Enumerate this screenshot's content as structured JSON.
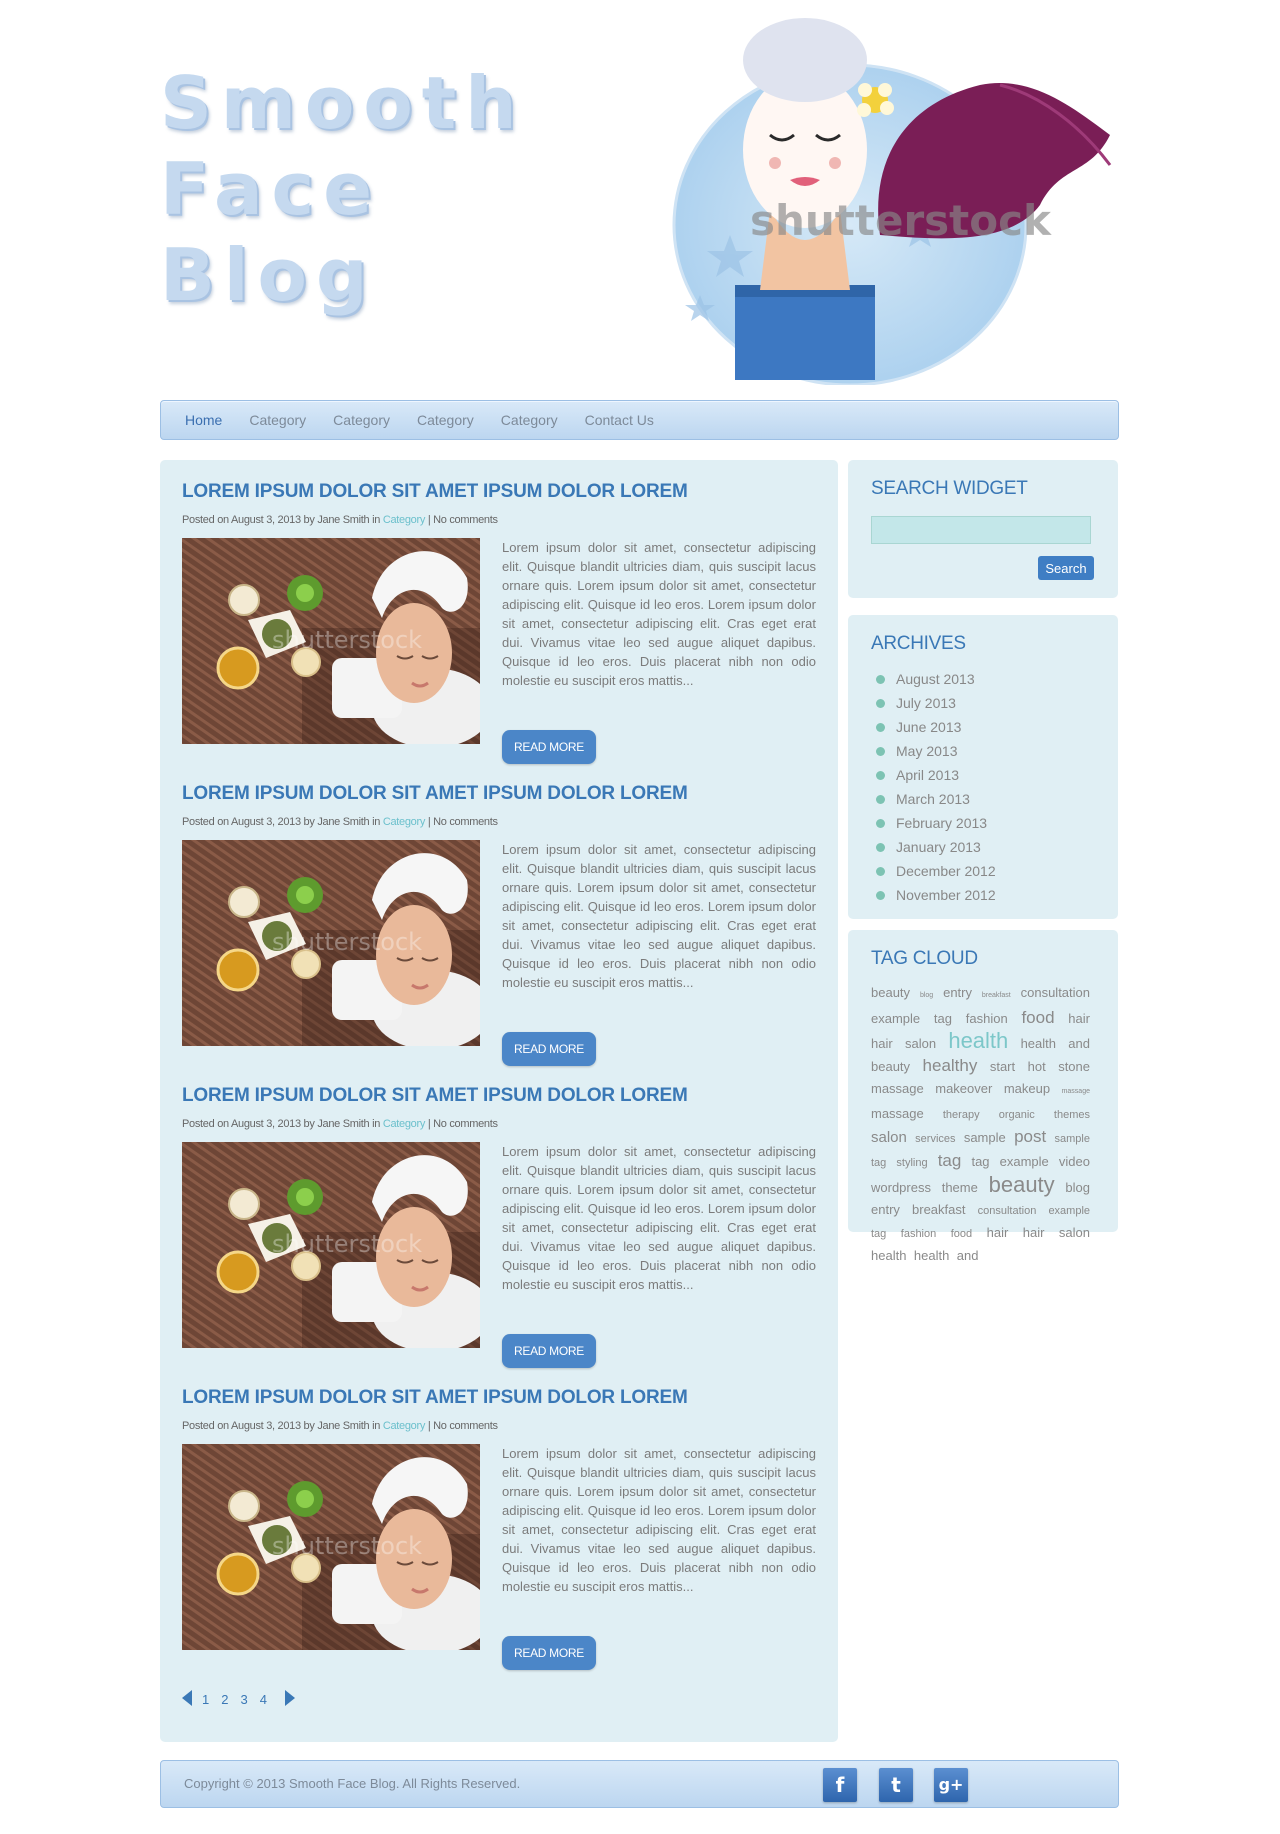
{
  "site": {
    "logo_lines": [
      "Smooth",
      "Face",
      "Blog"
    ],
    "hero_watermark": "shutterstock",
    "thumb_watermark": "shutterstock"
  },
  "nav": {
    "items": [
      {
        "label": "Home",
        "active": true
      },
      {
        "label": "Category"
      },
      {
        "label": "Category"
      },
      {
        "label": "Category"
      },
      {
        "label": "Category"
      },
      {
        "label": "Contact Us"
      }
    ]
  },
  "posts": [
    {
      "title": "LOREM IPSUM DOLOR SIT AMET IPSUM DOLOR LOREM",
      "meta_prefix": "Posted on August 3, 2013 by Jane Smith in ",
      "category": "Category",
      "meta_suffix": " | No comments",
      "excerpt": "Lorem ipsum dolor sit amet, consectetur adipiscing elit. Quisque blandit ultricies diam, quis suscipit lacus ornare quis. Lorem ipsum dolor sit amet, consectetur adipiscing elit. Quisque id leo eros. Lorem ipsum dolor sit amet, consectetur adipiscing elit. Cras eget erat dui. Vivamus vitae leo sed augue aliquet dapibus. Quisque id leo eros. Duis placerat nibh non odio molestie eu suscipit eros mattis...",
      "button": "READ MORE"
    },
    {
      "title": "LOREM IPSUM DOLOR SIT AMET IPSUM DOLOR LOREM",
      "meta_prefix": "Posted on August 3, 2013 by Jane Smith in ",
      "category": "Category",
      "meta_suffix": " | No comments",
      "excerpt": "Lorem ipsum dolor sit amet, consectetur adipiscing elit. Quisque blandit ultricies diam, quis suscipit lacus ornare quis. Lorem ipsum dolor sit amet, consectetur adipiscing elit. Quisque id leo eros. Lorem ipsum dolor sit amet, consectetur adipiscing elit. Cras eget erat dui. Vivamus vitae leo sed augue aliquet dapibus. Quisque id leo eros. Duis placerat nibh non odio molestie eu suscipit eros mattis...",
      "button": "READ MORE"
    },
    {
      "title": "LOREM IPSUM DOLOR SIT AMET IPSUM DOLOR LOREM",
      "meta_prefix": "Posted on August 3, 2013 by Jane Smith in ",
      "category": "Category",
      "meta_suffix": " | No comments",
      "excerpt": "Lorem ipsum dolor sit amet, consectetur adipiscing elit. Quisque blandit ultricies diam, quis suscipit lacus ornare quis. Lorem ipsum dolor sit amet, consectetur adipiscing elit. Quisque id leo eros. Lorem ipsum dolor sit amet, consectetur adipiscing elit. Cras eget erat dui. Vivamus vitae leo sed augue aliquet dapibus. Quisque id leo eros. Duis placerat nibh non odio molestie eu suscipit eros mattis...",
      "button": "READ MORE"
    },
    {
      "title": "LOREM IPSUM DOLOR SIT AMET IPSUM DOLOR LOREM",
      "meta_prefix": "Posted on August 3, 2013 by Jane Smith in ",
      "category": "Category",
      "meta_suffix": " | No comments",
      "excerpt": "Lorem ipsum dolor sit amet, consectetur adipiscing elit. Quisque blandit ultricies diam, quis suscipit lacus ornare quis. Lorem ipsum dolor sit amet, consectetur adipiscing elit. Quisque id leo eros. Lorem ipsum dolor sit amet, consectetur adipiscing elit. Cras eget erat dui. Vivamus vitae leo sed augue aliquet dapibus. Quisque id leo eros. Duis placerat nibh non odio molestie eu suscipit eros mattis...",
      "button": "READ MORE"
    }
  ],
  "pagination": {
    "pages": [
      "1",
      "2",
      "3",
      "4"
    ],
    "prev_icon": "triangle-left-icon",
    "next_icon": "triangle-right-icon"
  },
  "search_widget": {
    "title": "SEARCH WIDGET",
    "input_value": "",
    "button": "Search"
  },
  "archives": {
    "title": "ARCHIVES",
    "items": [
      "August 2013",
      "July 2013",
      "June 2013",
      "May 2013",
      "April 2013",
      "March 2013",
      "February 2013",
      "January 2013",
      "December 2012",
      "November 2012"
    ]
  },
  "tag_cloud": {
    "title": "TAG CLOUD",
    "tags": [
      {
        "text": "beauty",
        "size": 2
      },
      {
        "text": "blog",
        "size": 0
      },
      {
        "text": "entry",
        "size": 2
      },
      {
        "text": "breakfast",
        "size": 0
      },
      {
        "text": "consultation",
        "size": 2
      },
      {
        "text": "example",
        "size": 2
      },
      {
        "text": "tag",
        "size": 2
      },
      {
        "text": "fashion",
        "size": 2
      },
      {
        "text": "food",
        "size": 4
      },
      {
        "text": "hair",
        "size": 2
      },
      {
        "text": "hair",
        "size": 2
      },
      {
        "text": "salon",
        "size": 2
      },
      {
        "text": "health",
        "size": 6
      },
      {
        "text": "health",
        "size": 2
      },
      {
        "text": "and",
        "size": 2
      },
      {
        "text": "beauty",
        "size": 2
      },
      {
        "text": "healthy",
        "size": 4
      },
      {
        "text": "start",
        "size": 2
      },
      {
        "text": "hot",
        "size": 2
      },
      {
        "text": "stone",
        "size": 2
      },
      {
        "text": "massage",
        "size": 2
      },
      {
        "text": "makeover",
        "size": 2
      },
      {
        "text": "makeup",
        "size": 2
      },
      {
        "text": "massage",
        "size": 0
      },
      {
        "text": "massage",
        "size": 2
      },
      {
        "text": "therapy",
        "size": 1
      },
      {
        "text": "organic",
        "size": 1
      },
      {
        "text": "themes",
        "size": 1
      },
      {
        "text": "salon",
        "size": 3
      },
      {
        "text": "services",
        "size": 1
      },
      {
        "text": "sample",
        "size": 2
      },
      {
        "text": "post",
        "size": 4
      },
      {
        "text": "sample",
        "size": 1
      },
      {
        "text": "tag",
        "size": 1
      },
      {
        "text": "styling",
        "size": 1
      },
      {
        "text": "tag",
        "size": 4
      },
      {
        "text": "tag",
        "size": 2
      },
      {
        "text": "example",
        "size": 2
      },
      {
        "text": "video",
        "size": 2
      },
      {
        "text": "wordpress",
        "size": 2
      },
      {
        "text": "theme",
        "size": 2
      },
      {
        "text": "beauty",
        "size": 5
      },
      {
        "text": "blog",
        "size": 2
      },
      {
        "text": "entry",
        "size": 2
      },
      {
        "text": "breakfast",
        "size": 2
      },
      {
        "text": "consultation",
        "size": 1
      },
      {
        "text": "example",
        "size": 1
      },
      {
        "text": "tag",
        "size": 1
      },
      {
        "text": "fashion",
        "size": 1
      },
      {
        "text": "food",
        "size": 1
      },
      {
        "text": "hair",
        "size": 2
      },
      {
        "text": "hair",
        "size": 2
      },
      {
        "text": "salon",
        "size": 2
      },
      {
        "text": "health",
        "size": 2
      },
      {
        "text": "health",
        "size": 2
      },
      {
        "text": "and",
        "size": 2
      }
    ]
  },
  "footer": {
    "copyright": "Copyright © 2013 Smooth Face Blog. All Rights Reserved.",
    "social": [
      {
        "icon": "facebook-icon",
        "glyph": "f"
      },
      {
        "icon": "twitter-icon",
        "glyph": "t"
      },
      {
        "icon": "google-plus-icon",
        "glyph": "g+"
      }
    ]
  },
  "colors": {
    "accent": "#3a78b6",
    "panel": "#e0eff4",
    "button": "#4b86c8",
    "bullet": "#7dc3b3",
    "category_link": "#6cc0cc"
  }
}
